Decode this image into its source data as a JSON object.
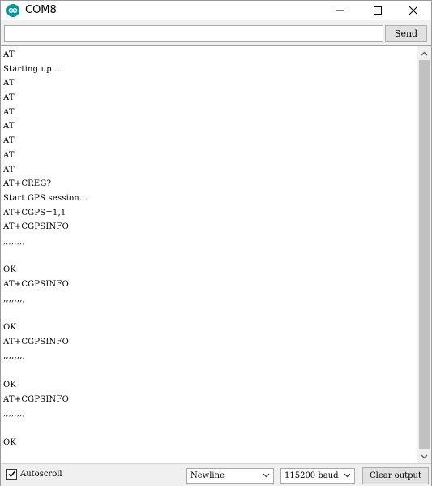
{
  "window": {
    "title": "COM8",
    "app_icon": "arduino-icon",
    "controls": [
      "minimize-icon",
      "maximize-icon",
      "close-icon"
    ]
  },
  "send_bar": {
    "input_value": "",
    "send_label": "Send"
  },
  "output": {
    "lines": [
      "AT",
      "Starting up...",
      "AT",
      "AT",
      "AT",
      "AT",
      "AT",
      "AT",
      "AT",
      "AT+CREG?",
      "Start GPS session...",
      "AT+CGPS=1,1",
      "AT+CGPSINFO",
      ",,,,,,,,",
      "",
      "OK",
      "AT+CGPSINFO",
      ",,,,,,,,",
      "",
      "OK",
      "AT+CGPSINFO",
      ",,,,,,,,",
      "",
      "OK",
      "AT+CGPSINFO",
      ",,,,,,,,",
      "",
      "OK"
    ]
  },
  "bottom_bar": {
    "autoscroll_label": "Autoscroll",
    "autoscroll_checked": true,
    "line_ending": "Newline",
    "baud_rate": "115200 baud",
    "clear_label": "Clear output"
  },
  "colors": {
    "arduino_teal": "#00979c",
    "chrome_bg": "#f0f0f0",
    "scroll_thumb": "#c1c1c1"
  }
}
